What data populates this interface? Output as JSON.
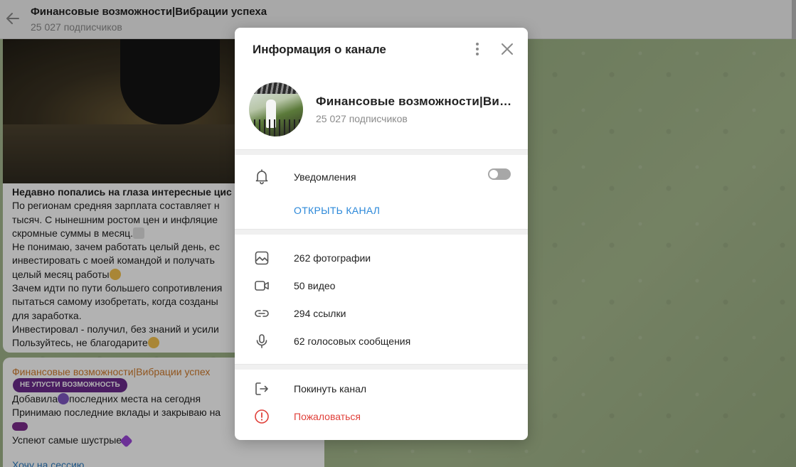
{
  "background": {
    "header": {
      "title": "Финансовые возможности|Вибрации успеха",
      "subscribers": "25 027 подписчиков"
    },
    "post1": {
      "lines": [
        "Недавно попались на глаза интересные цис",
        "По регионам средняя зарплата составляет н",
        "тысяч. С нынешним ростом цен и инфляцие",
        "скромные суммы в месяц.",
        "Не понимаю, зачем работать целый день, ес",
        "инвестировать с моей командой и получать",
        "целый месяц работы",
        "Зачем идти по пути большего сопротивления",
        "пытаться самому изобретать, когда созданы",
        "для заработка.",
        "Инвестировал - получил, без знаний и усили",
        "Пользуйтесь, не благодарите"
      ]
    },
    "post2": {
      "author": "Финансовые возможности|Вибрации успех",
      "badge": "НЕ УПУСТИ ВОЗМОЖНОСТЬ",
      "lines": [
        "Добавила",
        "последних места на сегодня",
        "Принимаю последние вклады и закрываю на",
        "Успеют самые шустрые"
      ],
      "link": "Хочу на сессию"
    }
  },
  "modal": {
    "title": "Информация о канале",
    "more_icon": "more-vertical-icon",
    "close_icon": "close-icon",
    "channel": {
      "name": "Финансовые возможности|Вибрации успеха",
      "subscribers": "25 027 подписчиков"
    },
    "notifications": {
      "label": "Уведомления",
      "enabled": false,
      "icon": "bell-icon"
    },
    "open_channel": "ОТКРЫТЬ КАНАЛ",
    "media": [
      {
        "icon": "photo-icon",
        "label": "262 фотографии"
      },
      {
        "icon": "video-icon",
        "label": "50 видео"
      },
      {
        "icon": "link-icon",
        "label": "294 ссылки"
      },
      {
        "icon": "microphone-icon",
        "label": "62 голосовых сообщения"
      }
    ],
    "leave": {
      "icon": "leave-icon",
      "label": "Покинуть канал"
    },
    "report": {
      "icon": "report-icon",
      "label": "Пожаловаться"
    }
  },
  "colors": {
    "accent": "#2b88d9",
    "danger": "#e0403a",
    "author": "#cf7a2c",
    "badge": "#6a2a8c"
  }
}
